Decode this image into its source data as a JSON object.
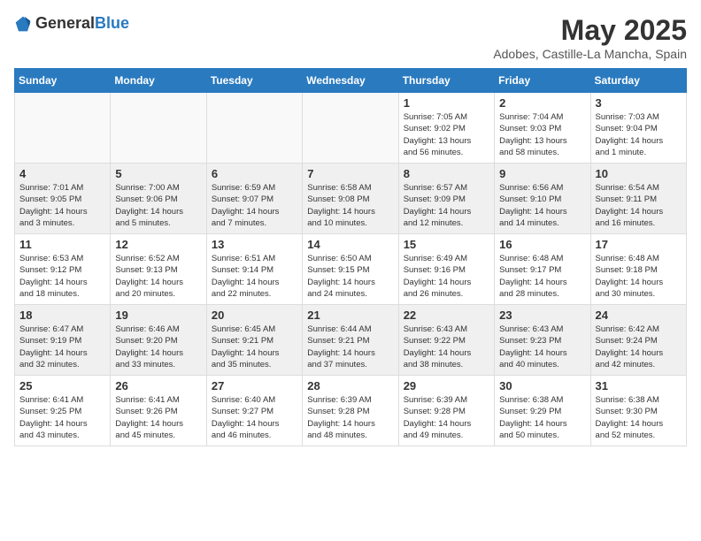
{
  "header": {
    "logo_general": "General",
    "logo_blue": "Blue",
    "month_title": "May 2025",
    "location": "Adobes, Castille-La Mancha, Spain"
  },
  "days_of_week": [
    "Sunday",
    "Monday",
    "Tuesday",
    "Wednesday",
    "Thursday",
    "Friday",
    "Saturday"
  ],
  "weeks": [
    [
      {
        "day": "",
        "info": ""
      },
      {
        "day": "",
        "info": ""
      },
      {
        "day": "",
        "info": ""
      },
      {
        "day": "",
        "info": ""
      },
      {
        "day": "1",
        "info": "Sunrise: 7:05 AM\nSunset: 9:02 PM\nDaylight: 13 hours\nand 56 minutes."
      },
      {
        "day": "2",
        "info": "Sunrise: 7:04 AM\nSunset: 9:03 PM\nDaylight: 13 hours\nand 58 minutes."
      },
      {
        "day": "3",
        "info": "Sunrise: 7:03 AM\nSunset: 9:04 PM\nDaylight: 14 hours\nand 1 minute."
      }
    ],
    [
      {
        "day": "4",
        "info": "Sunrise: 7:01 AM\nSunset: 9:05 PM\nDaylight: 14 hours\nand 3 minutes."
      },
      {
        "day": "5",
        "info": "Sunrise: 7:00 AM\nSunset: 9:06 PM\nDaylight: 14 hours\nand 5 minutes."
      },
      {
        "day": "6",
        "info": "Sunrise: 6:59 AM\nSunset: 9:07 PM\nDaylight: 14 hours\nand 7 minutes."
      },
      {
        "day": "7",
        "info": "Sunrise: 6:58 AM\nSunset: 9:08 PM\nDaylight: 14 hours\nand 10 minutes."
      },
      {
        "day": "8",
        "info": "Sunrise: 6:57 AM\nSunset: 9:09 PM\nDaylight: 14 hours\nand 12 minutes."
      },
      {
        "day": "9",
        "info": "Sunrise: 6:56 AM\nSunset: 9:10 PM\nDaylight: 14 hours\nand 14 minutes."
      },
      {
        "day": "10",
        "info": "Sunrise: 6:54 AM\nSunset: 9:11 PM\nDaylight: 14 hours\nand 16 minutes."
      }
    ],
    [
      {
        "day": "11",
        "info": "Sunrise: 6:53 AM\nSunset: 9:12 PM\nDaylight: 14 hours\nand 18 minutes."
      },
      {
        "day": "12",
        "info": "Sunrise: 6:52 AM\nSunset: 9:13 PM\nDaylight: 14 hours\nand 20 minutes."
      },
      {
        "day": "13",
        "info": "Sunrise: 6:51 AM\nSunset: 9:14 PM\nDaylight: 14 hours\nand 22 minutes."
      },
      {
        "day": "14",
        "info": "Sunrise: 6:50 AM\nSunset: 9:15 PM\nDaylight: 14 hours\nand 24 minutes."
      },
      {
        "day": "15",
        "info": "Sunrise: 6:49 AM\nSunset: 9:16 PM\nDaylight: 14 hours\nand 26 minutes."
      },
      {
        "day": "16",
        "info": "Sunrise: 6:48 AM\nSunset: 9:17 PM\nDaylight: 14 hours\nand 28 minutes."
      },
      {
        "day": "17",
        "info": "Sunrise: 6:48 AM\nSunset: 9:18 PM\nDaylight: 14 hours\nand 30 minutes."
      }
    ],
    [
      {
        "day": "18",
        "info": "Sunrise: 6:47 AM\nSunset: 9:19 PM\nDaylight: 14 hours\nand 32 minutes."
      },
      {
        "day": "19",
        "info": "Sunrise: 6:46 AM\nSunset: 9:20 PM\nDaylight: 14 hours\nand 33 minutes."
      },
      {
        "day": "20",
        "info": "Sunrise: 6:45 AM\nSunset: 9:21 PM\nDaylight: 14 hours\nand 35 minutes."
      },
      {
        "day": "21",
        "info": "Sunrise: 6:44 AM\nSunset: 9:21 PM\nDaylight: 14 hours\nand 37 minutes."
      },
      {
        "day": "22",
        "info": "Sunrise: 6:43 AM\nSunset: 9:22 PM\nDaylight: 14 hours\nand 38 minutes."
      },
      {
        "day": "23",
        "info": "Sunrise: 6:43 AM\nSunset: 9:23 PM\nDaylight: 14 hours\nand 40 minutes."
      },
      {
        "day": "24",
        "info": "Sunrise: 6:42 AM\nSunset: 9:24 PM\nDaylight: 14 hours\nand 42 minutes."
      }
    ],
    [
      {
        "day": "25",
        "info": "Sunrise: 6:41 AM\nSunset: 9:25 PM\nDaylight: 14 hours\nand 43 minutes."
      },
      {
        "day": "26",
        "info": "Sunrise: 6:41 AM\nSunset: 9:26 PM\nDaylight: 14 hours\nand 45 minutes."
      },
      {
        "day": "27",
        "info": "Sunrise: 6:40 AM\nSunset: 9:27 PM\nDaylight: 14 hours\nand 46 minutes."
      },
      {
        "day": "28",
        "info": "Sunrise: 6:39 AM\nSunset: 9:28 PM\nDaylight: 14 hours\nand 48 minutes."
      },
      {
        "day": "29",
        "info": "Sunrise: 6:39 AM\nSunset: 9:28 PM\nDaylight: 14 hours\nand 49 minutes."
      },
      {
        "day": "30",
        "info": "Sunrise: 6:38 AM\nSunset: 9:29 PM\nDaylight: 14 hours\nand 50 minutes."
      },
      {
        "day": "31",
        "info": "Sunrise: 6:38 AM\nSunset: 9:30 PM\nDaylight: 14 hours\nand 52 minutes."
      }
    ]
  ]
}
